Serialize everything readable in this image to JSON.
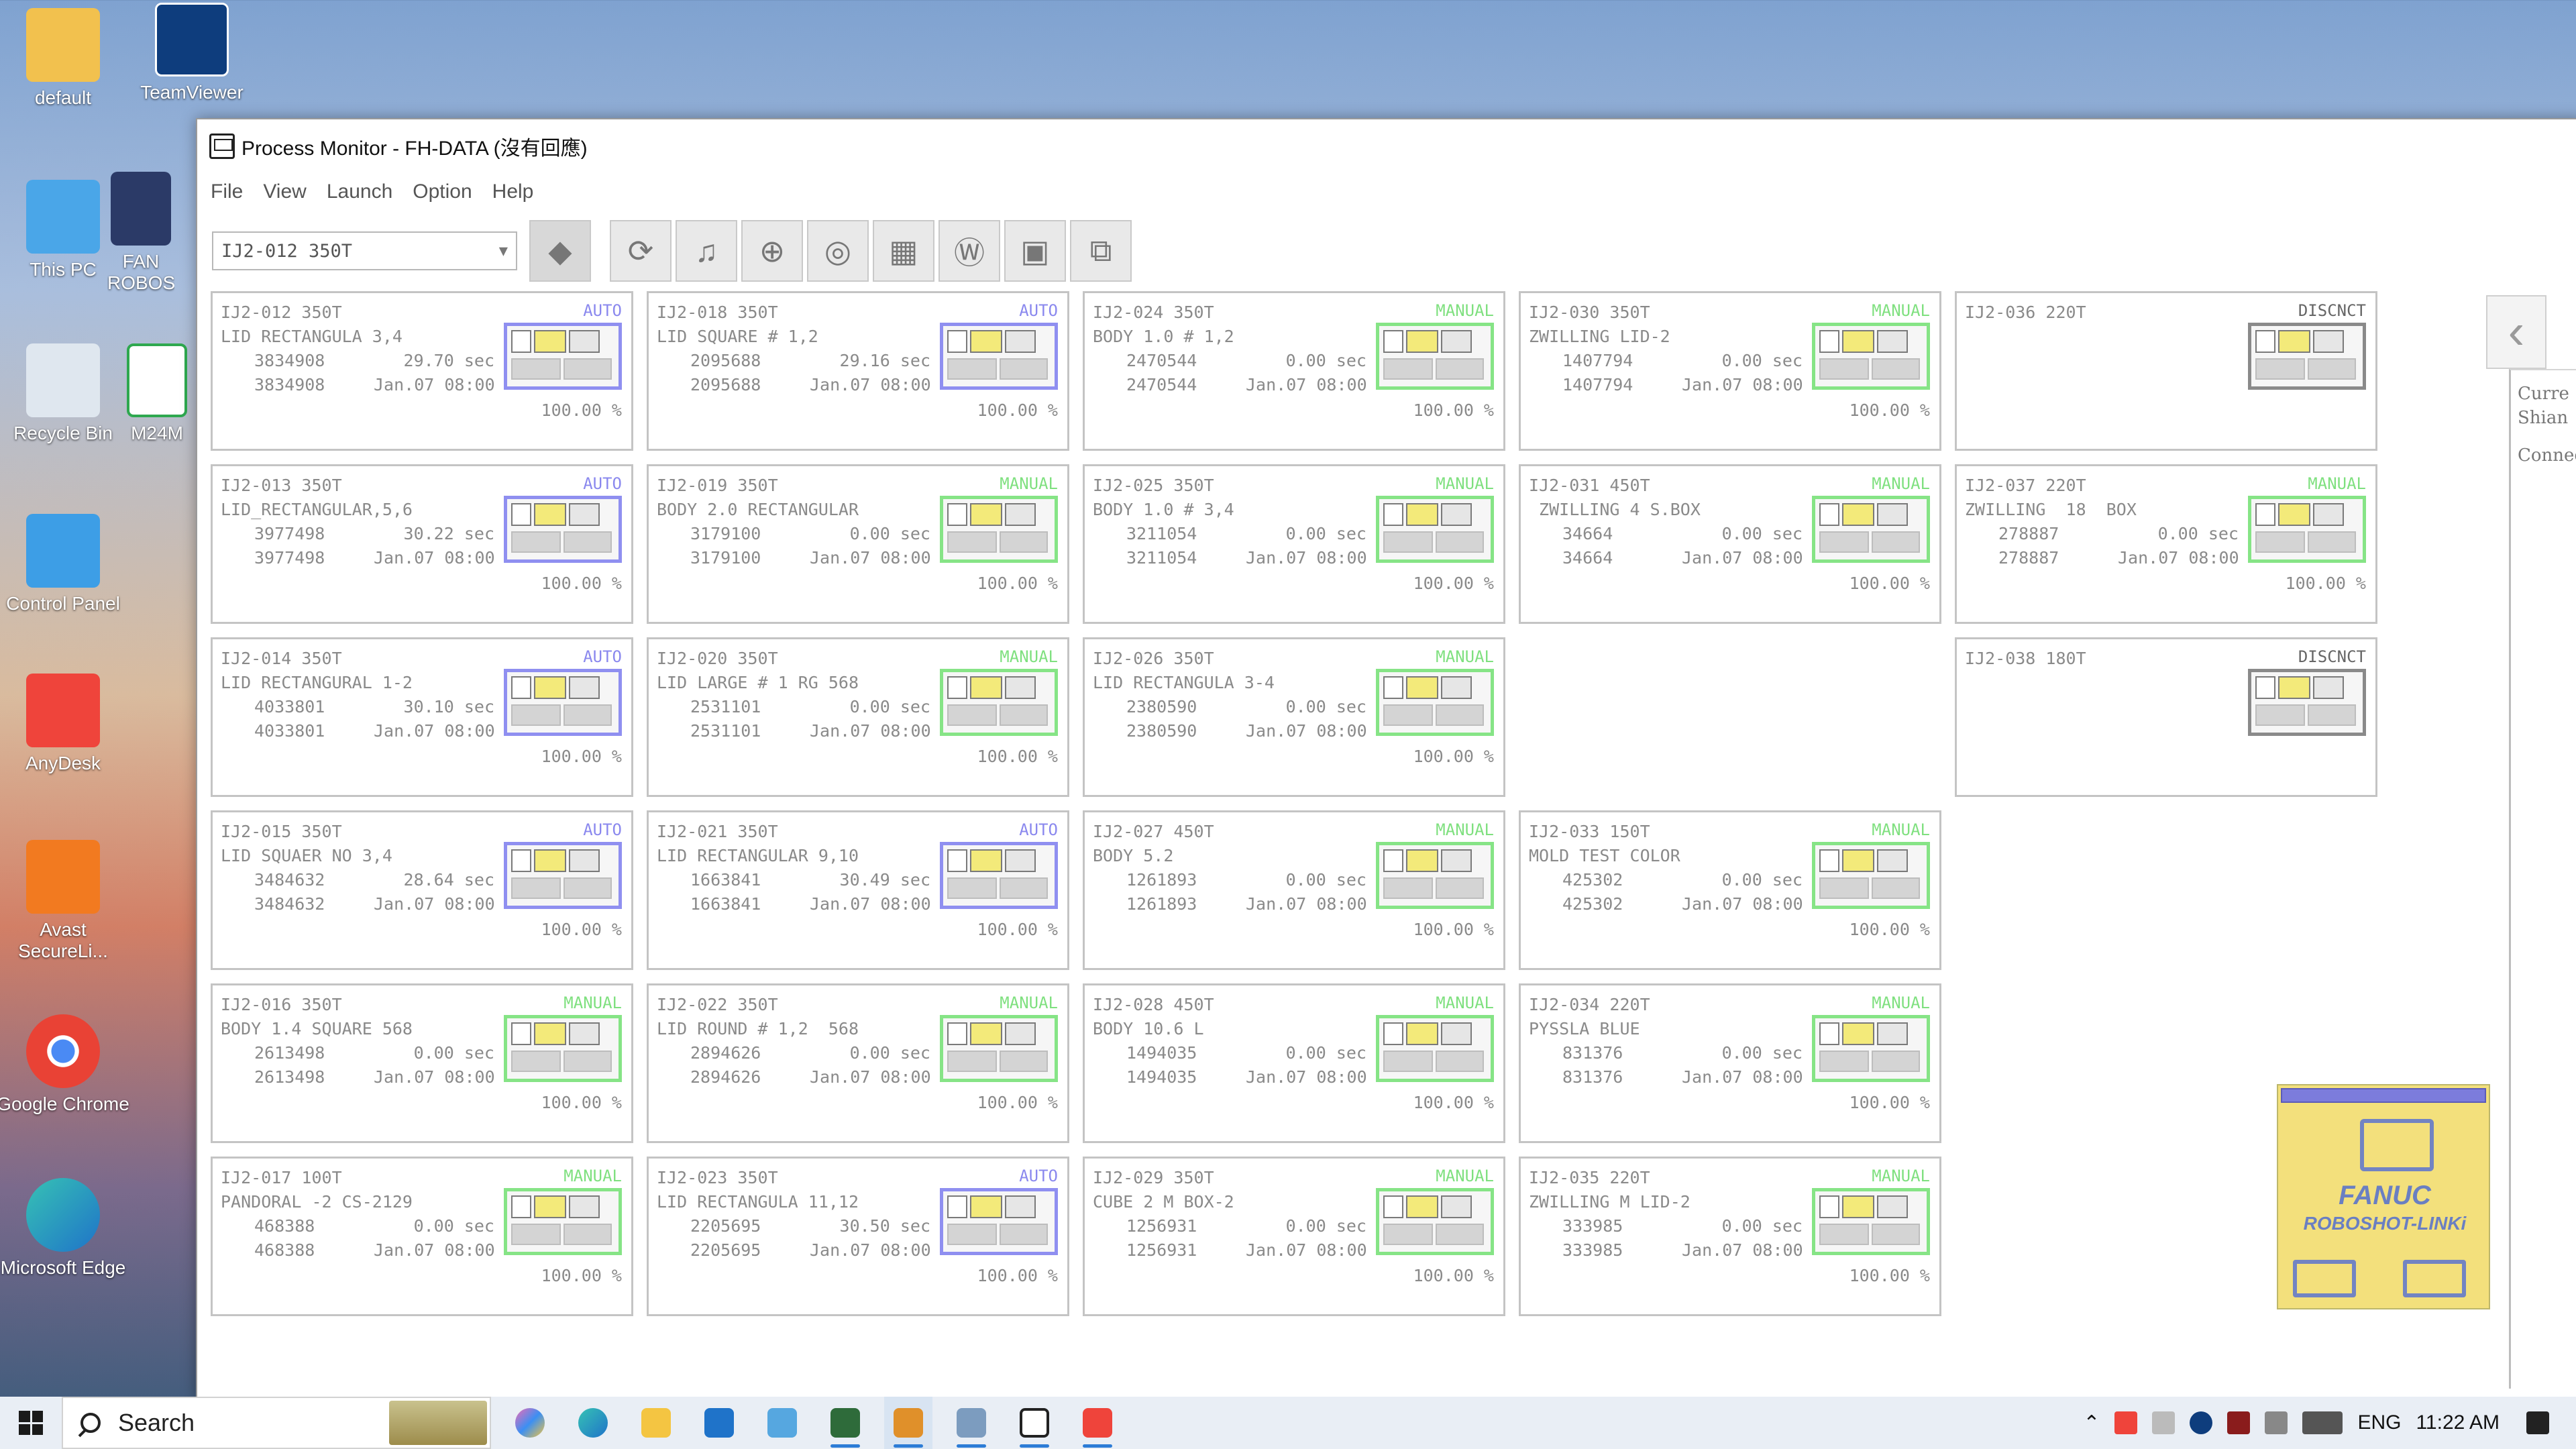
{
  "desktop": {
    "icons": [
      {
        "label": "default",
        "name": "default-user-folder"
      },
      {
        "label": "TeamViewer",
        "name": "teamviewer"
      },
      {
        "label": "This PC",
        "name": "this-pc"
      },
      {
        "label": "FAN ROBOS",
        "name": "fanuc-roboshot"
      },
      {
        "label": "Recycle Bin",
        "name": "recycle-bin"
      },
      {
        "label": "M24M",
        "name": "m24m"
      },
      {
        "label": "Control Panel",
        "name": "control-panel"
      },
      {
        "label": "AnyDesk",
        "name": "anydesk"
      },
      {
        "label": "Avast SecureLi...",
        "name": "avast-secureline"
      },
      {
        "label": "Google Chrome",
        "name": "google-chrome"
      },
      {
        "label": "Microsoft Edge",
        "name": "microsoft-edge"
      }
    ]
  },
  "window": {
    "title": "Process Monitor - FH-DATA (沒有回應)",
    "menu": [
      "File",
      "View",
      "Launch",
      "Option",
      "Help"
    ],
    "toolbar": {
      "machine_select_value": "IJ2-012 350T",
      "buttons": [
        "refresh-icon",
        "alarm-bell-icon",
        "search-zoom-icon",
        "trend-chart-icon",
        "grid-layout-icon",
        "weight-w-icon",
        "monitor-icon",
        "network-icon"
      ]
    }
  },
  "colors": {
    "auto": "#8a88ee",
    "manual": "#7fe07f",
    "disconnected": "#666666"
  },
  "machines": [
    {
      "id": "IJ2-012 350T",
      "status": "AUTO",
      "part": "LID RECTANGULA 3,4",
      "shots1": "3834908",
      "cycle": "29.70 sec",
      "shots2": "3834908",
      "date": "Jan.07 08:00",
      "pct": "100.00 %"
    },
    {
      "id": "IJ2-018 350T",
      "status": "AUTO",
      "part": "LID SQUARE # 1,2",
      "shots1": "2095688",
      "cycle": "29.16 sec",
      "shots2": "2095688",
      "date": "Jan.07 08:00",
      "pct": "100.00 %"
    },
    {
      "id": "IJ2-024 350T",
      "status": "MANUAL",
      "part": "BODY 1.0 # 1,2",
      "shots1": "2470544",
      "cycle": "0.00 sec",
      "shots2": "2470544",
      "date": "Jan.07 08:00",
      "pct": "100.00 %"
    },
    {
      "id": "IJ2-030 350T",
      "status": "MANUAL",
      "part": "ZWILLING LID-2",
      "shots1": "1407794",
      "cycle": "0.00 sec",
      "shots2": "1407794",
      "date": "Jan.07 08:00",
      "pct": "100.00 %"
    },
    {
      "id": "IJ2-036 220T",
      "status": "DISCNCT",
      "part": "",
      "shots1": "",
      "cycle": "",
      "shots2": "",
      "date": "",
      "pct": ""
    },
    {
      "id": "IJ2-013 350T",
      "status": "AUTO",
      "part": "LID_RECTANGULAR,5,6",
      "shots1": "3977498",
      "cycle": "30.22 sec",
      "shots2": "3977498",
      "date": "Jan.07 08:00",
      "pct": "100.00 %"
    },
    {
      "id": "IJ2-019 350T",
      "status": "MANUAL",
      "part": "BODY 2.0 RECTANGULAR",
      "shots1": "3179100",
      "cycle": "0.00 sec",
      "shots2": "3179100",
      "date": "Jan.07 08:00",
      "pct": "100.00 %"
    },
    {
      "id": "IJ2-025 350T",
      "status": "MANUAL",
      "part": "BODY 1.0 # 3,4",
      "shots1": "3211054",
      "cycle": "0.00 sec",
      "shots2": "3211054",
      "date": "Jan.07 08:00",
      "pct": "100.00 %"
    },
    {
      "id": "IJ2-031 450T",
      "status": "MANUAL",
      "part": " ZWILLING 4 S.BOX",
      "shots1": "34664",
      "cycle": "0.00 sec",
      "shots2": "34664",
      "date": "Jan.07 08:00",
      "pct": "100.00 %"
    },
    {
      "id": "IJ2-037 220T",
      "status": "MANUAL",
      "part": "ZWILLING  18  BOX",
      "shots1": "278887",
      "cycle": "0.00 sec",
      "shots2": "278887",
      "date": "Jan.07 08:00",
      "pct": "100.00 %"
    },
    {
      "id": "IJ2-014 350T",
      "status": "AUTO",
      "part": "LID RECTANGURAL 1-2",
      "shots1": "4033801",
      "cycle": "30.10 sec",
      "shots2": "4033801",
      "date": "Jan.07 08:00",
      "pct": "100.00 %"
    },
    {
      "id": "IJ2-020 350T",
      "status": "MANUAL",
      "part": "LID LARGE # 1 RG 568",
      "shots1": "2531101",
      "cycle": "0.00 sec",
      "shots2": "2531101",
      "date": "Jan.07 08:00",
      "pct": "100.00 %"
    },
    {
      "id": "IJ2-026 350T",
      "status": "MANUAL",
      "part": "LID RECTANGULA 3-4",
      "shots1": "2380590",
      "cycle": "0.00 sec",
      "shots2": "2380590",
      "date": "Jan.07 08:00",
      "pct": "100.00 %"
    },
    {
      "id": "IJ2-038 180T",
      "status": "DISCNCT",
      "part": "",
      "shots1": "",
      "cycle": "",
      "shots2": "",
      "date": "",
      "pct": ""
    },
    {
      "id": "IJ2-015 350T",
      "status": "AUTO",
      "part": "LID SQUAER NO 3,4",
      "shots1": "3484632",
      "cycle": "28.64 sec",
      "shots2": "3484632",
      "date": "Jan.07 08:00",
      "pct": "100.00 %"
    },
    {
      "id": "IJ2-021 350T",
      "status": "AUTO",
      "part": "LID RECTANGULAR 9,10",
      "shots1": "1663841",
      "cycle": "30.49 sec",
      "shots2": "1663841",
      "date": "Jan.07 08:00",
      "pct": "100.00 %"
    },
    {
      "id": "IJ2-027 450T",
      "status": "MANUAL",
      "part": "BODY 5.2",
      "shots1": "1261893",
      "cycle": "0.00 sec",
      "shots2": "1261893",
      "date": "Jan.07 08:00",
      "pct": "100.00 %"
    },
    {
      "id": "IJ2-033 150T",
      "status": "MANUAL",
      "part": "MOLD TEST COLOR",
      "shots1": "425302",
      "cycle": "0.00 sec",
      "shots2": "425302",
      "date": "Jan.07 08:00",
      "pct": "100.00 %"
    },
    {
      "id": "IJ2-016 350T",
      "status": "MANUAL",
      "part": "BODY 1.4 SQUARE 568",
      "shots1": "2613498",
      "cycle": "0.00 sec",
      "shots2": "2613498",
      "date": "Jan.07 08:00",
      "pct": "100.00 %"
    },
    {
      "id": "IJ2-022 350T",
      "status": "MANUAL",
      "part": "LID ROUND # 1,2  568",
      "shots1": "2894626",
      "cycle": "0.00 sec",
      "shots2": "2894626",
      "date": "Jan.07 08:00",
      "pct": "100.00 %"
    },
    {
      "id": "IJ2-028 450T",
      "status": "MANUAL",
      "part": "BODY 10.6 L",
      "shots1": "1494035",
      "cycle": "0.00 sec",
      "shots2": "1494035",
      "date": "Jan.07 08:00",
      "pct": "100.00 %"
    },
    {
      "id": "IJ2-034 220T",
      "status": "MANUAL",
      "part": "PYSSLA BLUE",
      "shots1": "831376",
      "cycle": "0.00 sec",
      "shots2": "831376",
      "date": "Jan.07 08:00",
      "pct": "100.00 %"
    },
    {
      "id": "IJ2-017 100T",
      "status": "MANUAL",
      "part": "PANDORAL -2 CS-2129",
      "shots1": "468388",
      "cycle": "0.00 sec",
      "shots2": "468388",
      "date": "Jan.07 08:00",
      "pct": "100.00 %"
    },
    {
      "id": "IJ2-023 350T",
      "status": "AUTO",
      "part": "LID RECTANGULA 11,12",
      "shots1": "2205695",
      "cycle": "30.50 sec",
      "shots2": "2205695",
      "date": "Jan.07 08:00",
      "pct": "100.00 %"
    },
    {
      "id": "IJ2-029 350T",
      "status": "MANUAL",
      "part": "CUBE 2 M BOX-2",
      "shots1": "1256931",
      "cycle": "0.00 sec",
      "shots2": "1256931",
      "date": "Jan.07 08:00",
      "pct": "100.00 %"
    },
    {
      "id": "IJ2-035 220T",
      "status": "MANUAL",
      "part": "ZWILLING M LID-2",
      "shots1": "333985",
      "cycle": "0.00 sec",
      "shots2": "333985",
      "date": "Jan.07 08:00",
      "pct": "100.00 %"
    }
  ],
  "side_panel": {
    "line1": "Curre",
    "line2": "Shian",
    "line3": "Connec"
  },
  "fanuc_widget": {
    "line1": "FANUC",
    "line2": "ROBOSHOT-LINKi"
  },
  "taskbar": {
    "search_label": "Search",
    "language": "ENG",
    "time": "11:22 AM"
  }
}
